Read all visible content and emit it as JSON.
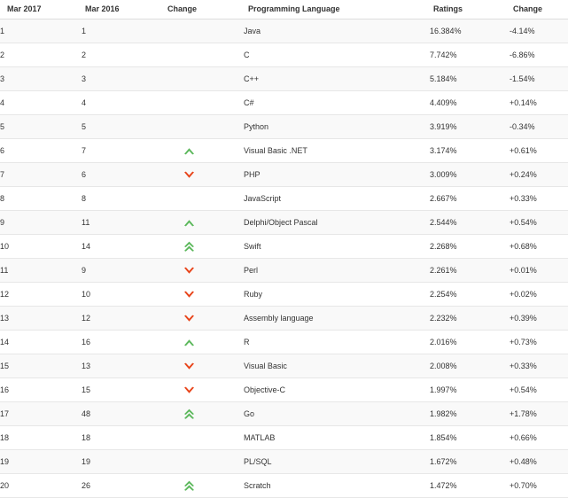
{
  "table": {
    "headers": {
      "rank_now": "Mar 2017",
      "rank_prev": "Mar 2016",
      "change_dir": "Change",
      "language": "Programming Language",
      "ratings": "Ratings",
      "change_pct": "Change"
    },
    "colors": {
      "up": "#5cb85c",
      "down": "#e8441a",
      "text": "#333333",
      "row_stripe": "#f9f9f9",
      "row_plain": "#ffffff",
      "border": "#e7e7e7",
      "header_border": "#dddddd"
    },
    "rows": [
      {
        "rank_now": "1",
        "rank_prev": "1",
        "change_dir": "none",
        "language": "Java",
        "ratings": "16.384%",
        "change_pct": "-4.14%"
      },
      {
        "rank_now": "2",
        "rank_prev": "2",
        "change_dir": "none",
        "language": "C",
        "ratings": "7.742%",
        "change_pct": "-6.86%"
      },
      {
        "rank_now": "3",
        "rank_prev": "3",
        "change_dir": "none",
        "language": "C++",
        "ratings": "5.184%",
        "change_pct": "-1.54%"
      },
      {
        "rank_now": "4",
        "rank_prev": "4",
        "change_dir": "none",
        "language": "C#",
        "ratings": "4.409%",
        "change_pct": "+0.14%"
      },
      {
        "rank_now": "5",
        "rank_prev": "5",
        "change_dir": "none",
        "language": "Python",
        "ratings": "3.919%",
        "change_pct": "-0.34%"
      },
      {
        "rank_now": "6",
        "rank_prev": "7",
        "change_dir": "up",
        "language": "Visual Basic .NET",
        "ratings": "3.174%",
        "change_pct": "+0.61%"
      },
      {
        "rank_now": "7",
        "rank_prev": "6",
        "change_dir": "down",
        "language": "PHP",
        "ratings": "3.009%",
        "change_pct": "+0.24%"
      },
      {
        "rank_now": "8",
        "rank_prev": "8",
        "change_dir": "none",
        "language": "JavaScript",
        "ratings": "2.667%",
        "change_pct": "+0.33%"
      },
      {
        "rank_now": "9",
        "rank_prev": "11",
        "change_dir": "up",
        "language": "Delphi/Object Pascal",
        "ratings": "2.544%",
        "change_pct": "+0.54%"
      },
      {
        "rank_now": "10",
        "rank_prev": "14",
        "change_dir": "double-up",
        "language": "Swift",
        "ratings": "2.268%",
        "change_pct": "+0.68%"
      },
      {
        "rank_now": "11",
        "rank_prev": "9",
        "change_dir": "down",
        "language": "Perl",
        "ratings": "2.261%",
        "change_pct": "+0.01%"
      },
      {
        "rank_now": "12",
        "rank_prev": "10",
        "change_dir": "down",
        "language": "Ruby",
        "ratings": "2.254%",
        "change_pct": "+0.02%"
      },
      {
        "rank_now": "13",
        "rank_prev": "12",
        "change_dir": "down",
        "language": "Assembly language",
        "ratings": "2.232%",
        "change_pct": "+0.39%"
      },
      {
        "rank_now": "14",
        "rank_prev": "16",
        "change_dir": "up",
        "language": "R",
        "ratings": "2.016%",
        "change_pct": "+0.73%"
      },
      {
        "rank_now": "15",
        "rank_prev": "13",
        "change_dir": "down",
        "language": "Visual Basic",
        "ratings": "2.008%",
        "change_pct": "+0.33%"
      },
      {
        "rank_now": "16",
        "rank_prev": "15",
        "change_dir": "down",
        "language": "Objective-C",
        "ratings": "1.997%",
        "change_pct": "+0.54%"
      },
      {
        "rank_now": "17",
        "rank_prev": "48",
        "change_dir": "double-up",
        "language": "Go",
        "ratings": "1.982%",
        "change_pct": "+1.78%"
      },
      {
        "rank_now": "18",
        "rank_prev": "18",
        "change_dir": "none",
        "language": "MATLAB",
        "ratings": "1.854%",
        "change_pct": "+0.66%"
      },
      {
        "rank_now": "19",
        "rank_prev": "19",
        "change_dir": "none",
        "language": "PL/SQL",
        "ratings": "1.672%",
        "change_pct": "+0.48%"
      },
      {
        "rank_now": "20",
        "rank_prev": "26",
        "change_dir": "double-up",
        "language": "Scratch",
        "ratings": "1.472%",
        "change_pct": "+0.70%"
      }
    ]
  }
}
